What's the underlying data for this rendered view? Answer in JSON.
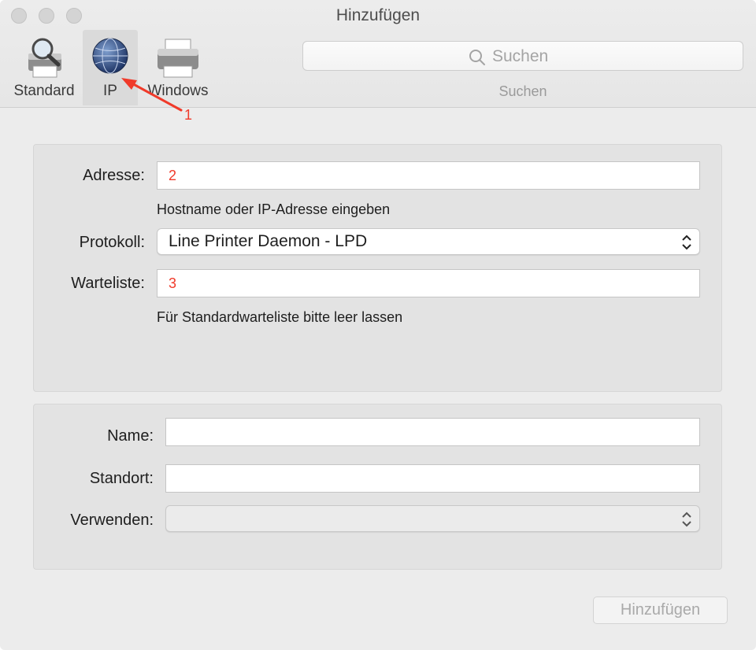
{
  "window": {
    "title": "Hinzufügen"
  },
  "toolbar": {
    "items": [
      {
        "label": "Standard",
        "icon": "printer-magnifier-icon"
      },
      {
        "label": "IP",
        "icon": "globe-icon",
        "selected": true
      },
      {
        "label": "Windows",
        "icon": "printer-icon"
      }
    ],
    "search": {
      "placeholder": "Suchen",
      "label": "Suchen"
    }
  },
  "connection": {
    "address": {
      "label": "Adresse:",
      "value": "",
      "hint": "Hostname oder IP-Adresse eingeben"
    },
    "protocol": {
      "label": "Protokoll:",
      "selected": "Line Printer Daemon - LPD"
    },
    "queue": {
      "label": "Warteliste:",
      "value": "",
      "hint": "Für Standardwarteliste bitte leer lassen"
    }
  },
  "printer": {
    "name": {
      "label": "Name:",
      "value": ""
    },
    "location": {
      "label": "Standort:",
      "value": ""
    },
    "use": {
      "label": "Verwenden:",
      "selected": ""
    }
  },
  "actions": {
    "add_label": "Hinzufügen"
  },
  "annotations": {
    "arrow_number": "1",
    "address_number": "2",
    "queue_number": "3",
    "color": "#f03a2a"
  }
}
